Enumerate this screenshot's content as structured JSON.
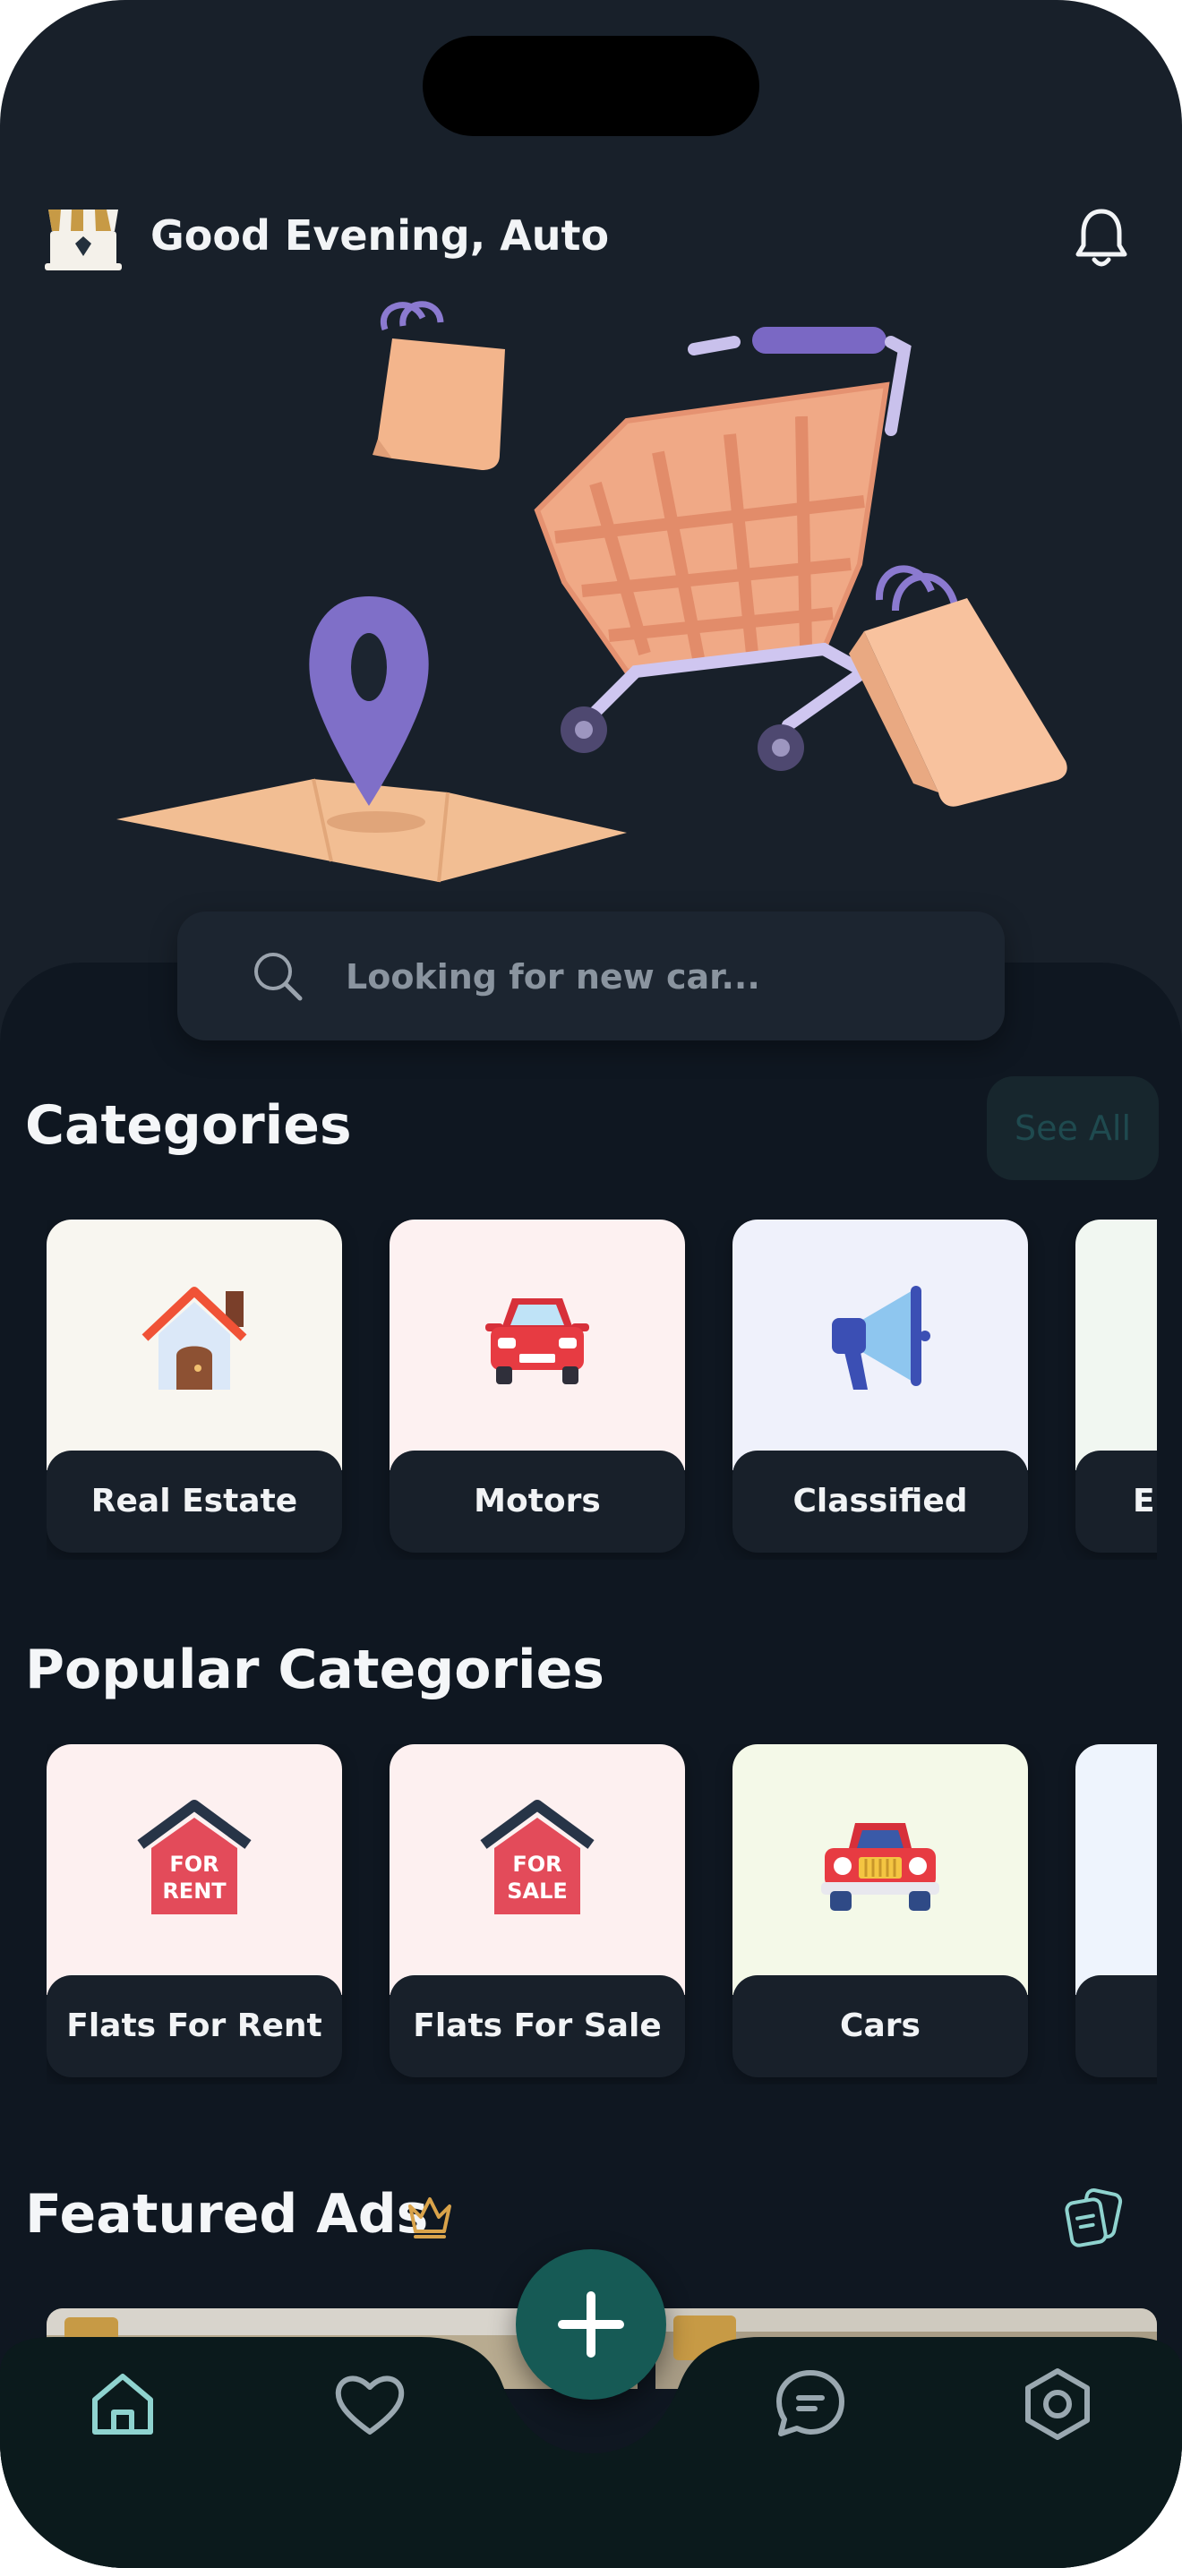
{
  "header": {
    "greeting": "Good Evening, Auto",
    "logo_icon": "storefront-icon",
    "notification_icon": "bell-icon"
  },
  "hero": {
    "illustration": "shopping-cart-bags-map-pin-illustration"
  },
  "search": {
    "placeholder": "Looking for new car...",
    "value": "",
    "icon": "search-icon"
  },
  "categories": {
    "title": "Categories",
    "see_all_label": "See All",
    "items": [
      {
        "label": "Real Estate",
        "icon": "house-icon",
        "bg": "#f8f6f0"
      },
      {
        "label": "Motors",
        "icon": "car-icon",
        "bg": "#fdf1f1"
      },
      {
        "label": "Classified",
        "icon": "megaphone-icon",
        "bg": "#eff1fb"
      },
      {
        "label": "El",
        "icon": "",
        "bg": "#f1f7f1"
      }
    ]
  },
  "popular_categories": {
    "title": "Popular Categories",
    "items": [
      {
        "label": "Flats For Rent",
        "icon": "for-rent-sign-icon",
        "sign_text": [
          "FOR",
          "RENT"
        ],
        "bg": "#fdf0f0"
      },
      {
        "label": "Flats For Sale",
        "icon": "for-sale-sign-icon",
        "sign_text": [
          "FOR",
          "SALE"
        ],
        "bg": "#fdf0f0"
      },
      {
        "label": "Cars",
        "icon": "jeep-icon",
        "bg": "#f4f9e8"
      },
      {
        "label": "",
        "icon": "",
        "bg": "#eef4fd"
      }
    ]
  },
  "featured_ads": {
    "title": "Featured Ads",
    "title_icon": "crown-icon",
    "action_icon": "document-icon"
  },
  "bottom_nav": {
    "items": [
      {
        "name": "home",
        "icon": "home-icon"
      },
      {
        "name": "favorites",
        "icon": "heart-icon"
      },
      {
        "name": "add",
        "icon": "plus-icon"
      },
      {
        "name": "messages",
        "icon": "chat-icon"
      },
      {
        "name": "settings",
        "icon": "settings-icon"
      }
    ]
  },
  "colors": {
    "background": "#18202a",
    "lower_panel": "#0f1721",
    "card_label_bg": "#18202a",
    "fab": "#165a55",
    "nav_bar": "#0b1a1c",
    "nav_icon_active": "#8fd3cf",
    "crown": "#d9a34a"
  }
}
